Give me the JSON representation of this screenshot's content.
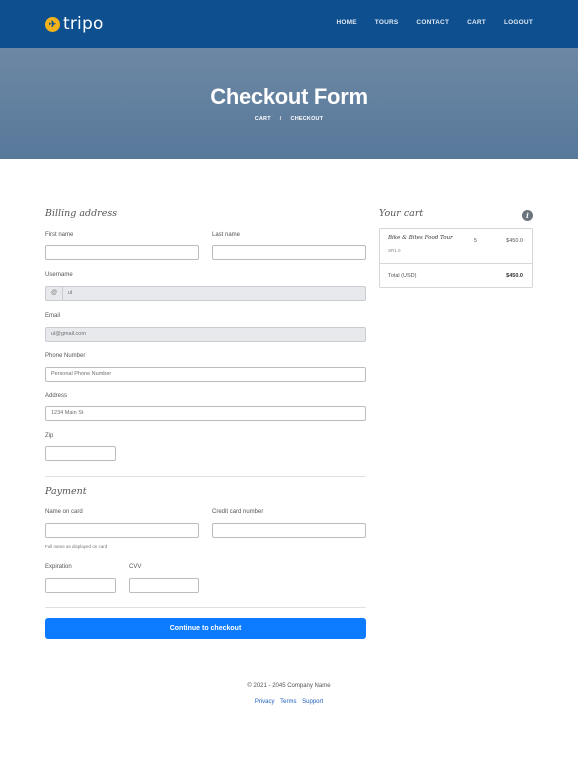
{
  "navbar": {
    "brand": "tripo",
    "logo_icon": "airplane-icon",
    "links": [
      "HOME",
      "TOURS",
      "CONTACT",
      "CART",
      "LOGOUT"
    ]
  },
  "hero": {
    "title": "Checkout Form",
    "breadcrumb": {
      "first": "CART",
      "separator": "/",
      "current": "CHECKOUT"
    }
  },
  "billing": {
    "title": "Billing address",
    "first_name": {
      "label": "First name",
      "value": ""
    },
    "last_name": {
      "label": "Last name",
      "value": ""
    },
    "username": {
      "label": "Username",
      "addon": "@",
      "value": "ul"
    },
    "email": {
      "label": "Email",
      "value": "ul@gmail.com"
    },
    "phone": {
      "label": "Phone Number",
      "placeholder": "Personal Phone Number"
    },
    "address": {
      "label": "Address",
      "placeholder": "1234 Main St"
    },
    "zip": {
      "label": "Zip",
      "value": ""
    }
  },
  "payment": {
    "title": "Payment",
    "name_on_card": {
      "label": "Name on card",
      "hint": "Full name as displayed on card"
    },
    "card_number": {
      "label": "Credit card number"
    },
    "expiration": {
      "label": "Expiration"
    },
    "cvv": {
      "label": "CVV"
    },
    "submit_label": "Continue to checkout"
  },
  "cart": {
    "title": "Your cart",
    "badge_icon": "info-icon",
    "badge_text": "i",
    "items": [
      {
        "name": "Bike & Bites Food Tour",
        "sub": "SR1.0",
        "qty": "5",
        "price": "$450.0"
      }
    ],
    "total_label": "Total (USD)",
    "total_value": "$450.0"
  },
  "footer": {
    "copyright": "© 2021 - 2045 Company Name",
    "links": [
      "Privacy",
      "Terms",
      "Support"
    ]
  },
  "colors": {
    "navbar": "#0d4f8f",
    "accent_button": "#0d7bff",
    "logo": "#f3b21b",
    "link": "#1f5fbf"
  }
}
